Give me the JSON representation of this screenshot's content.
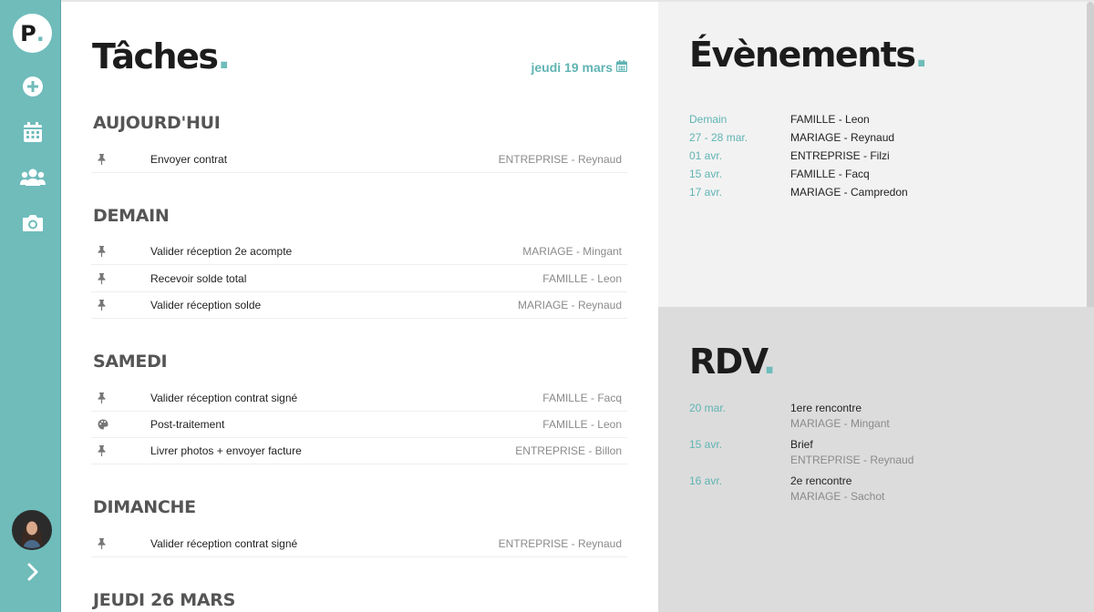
{
  "sidebar": {
    "logo_letter": "P",
    "logo_dot": ".",
    "nav_icons": [
      "add-circle-icon",
      "calendar-icon",
      "users-icon",
      "camera-icon"
    ],
    "expand_icon": "chevron-right-icon"
  },
  "tasks": {
    "title": "Tâches",
    "title_dot": ".",
    "date": "jeudi 19 mars",
    "sections": [
      {
        "heading": "AUJOURD'HUI",
        "items": [
          {
            "icon": "pin-icon",
            "name": "Envoyer contrat",
            "client": "ENTREPRISE - Reynaud"
          }
        ]
      },
      {
        "heading": "DEMAIN",
        "items": [
          {
            "icon": "pin-icon",
            "name": "Valider réception 2e acompte",
            "client": "MARIAGE - Mingant"
          },
          {
            "icon": "pin-icon",
            "name": "Recevoir solde total",
            "client": "FAMILLE - Leon"
          },
          {
            "icon": "pin-icon",
            "name": "Valider réception solde",
            "client": "MARIAGE - Reynaud"
          }
        ]
      },
      {
        "heading": "SAMEDI",
        "items": [
          {
            "icon": "pin-icon",
            "name": "Valider réception contrat signé",
            "client": "FAMILLE - Facq"
          },
          {
            "icon": "palette-icon",
            "name": "Post-traitement",
            "client": "FAMILLE - Leon"
          },
          {
            "icon": "pin-icon",
            "name": "Livrer photos + envoyer facture",
            "client": "ENTREPRISE - Billon"
          }
        ]
      },
      {
        "heading": "DIMANCHE",
        "items": [
          {
            "icon": "pin-icon",
            "name": "Valider réception contrat signé",
            "client": "ENTREPRISE - Reynaud"
          }
        ]
      },
      {
        "heading": "JEUDI 26 MARS",
        "items": []
      }
    ]
  },
  "events": {
    "title": "Évènements",
    "title_dot": ".",
    "items": [
      {
        "date": "Demain",
        "name": "FAMILLE - Leon"
      },
      {
        "date": "27 - 28 mar.",
        "name": "MARIAGE - Reynaud"
      },
      {
        "date": "01 avr.",
        "name": "ENTREPRISE - Filzi"
      },
      {
        "date": "15 avr.",
        "name": "FAMILLE - Facq"
      },
      {
        "date": "17 avr.",
        "name": "MARIAGE - Campredon"
      }
    ]
  },
  "rdv": {
    "title": "RDV",
    "title_dot": ".",
    "items": [
      {
        "date": "20 mar.",
        "name": "1ere rencontre",
        "client": "MARIAGE - Mingant"
      },
      {
        "date": "15 avr.",
        "name": "Brief",
        "client": "ENTREPRISE - Reynaud"
      },
      {
        "date": "16 avr.",
        "name": "2e rencontre",
        "client": "MARIAGE - Sachot"
      }
    ]
  },
  "colors": {
    "accent": "#6fbcbb",
    "sidebar": "#6fbcbb",
    "events_bg": "#f2f2f2",
    "rdv_bg": "#dcdcdc"
  }
}
